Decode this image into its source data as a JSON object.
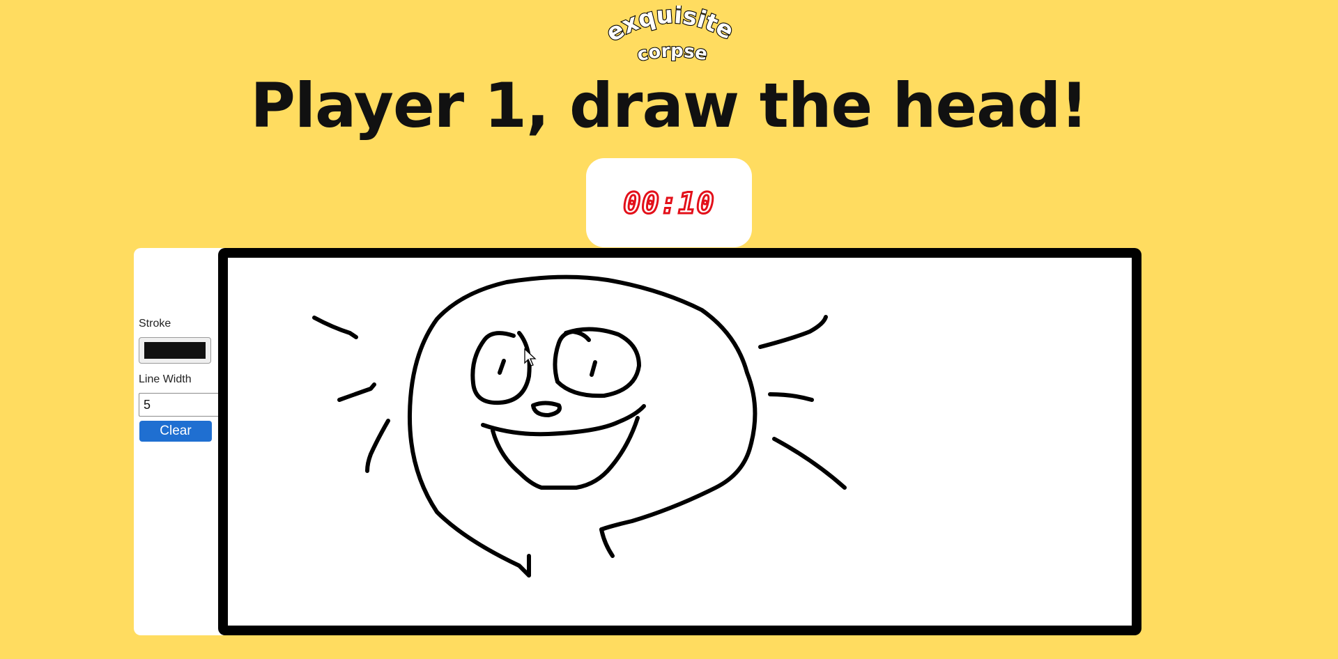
{
  "logo": {
    "line1": "exquisite",
    "line2": "corpse"
  },
  "heading": "Player 1, draw the head!",
  "timer": {
    "value": "00:10",
    "color": "#e3101a"
  },
  "tools": {
    "stroke_label": "Stroke",
    "stroke_color": "#111111",
    "line_width_label": "Line Width",
    "line_width_value": "5",
    "clear_label": "Clear",
    "clear_color": "#1f6fd1"
  },
  "colors": {
    "background": "#ffdc60",
    "canvas_border": "#000000",
    "canvas_fill": "#ffffff"
  }
}
